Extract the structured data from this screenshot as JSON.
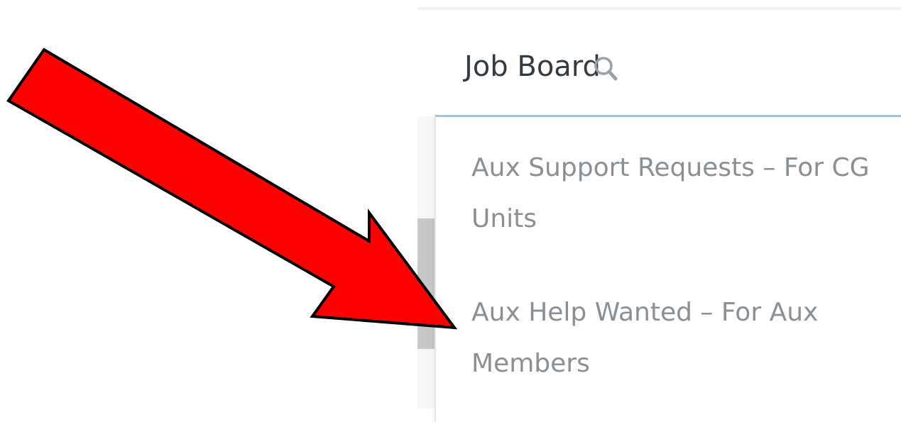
{
  "nav": {
    "title": "Job Board",
    "search_icon": "search-icon"
  },
  "dropdown": {
    "items": [
      {
        "label": "Aux Support Requests – For CG Units"
      },
      {
        "label": "Aux Help Wanted – For Aux Members"
      }
    ]
  },
  "annotation": {
    "arrow_icon": "arrow-pointer-icon",
    "arrow_color": "#ff0000",
    "arrow_outline": "#000000"
  },
  "colors": {
    "panel_border_accent": "#a8c4dc",
    "item_text": "#8a8f94",
    "title_text": "#333a40"
  }
}
